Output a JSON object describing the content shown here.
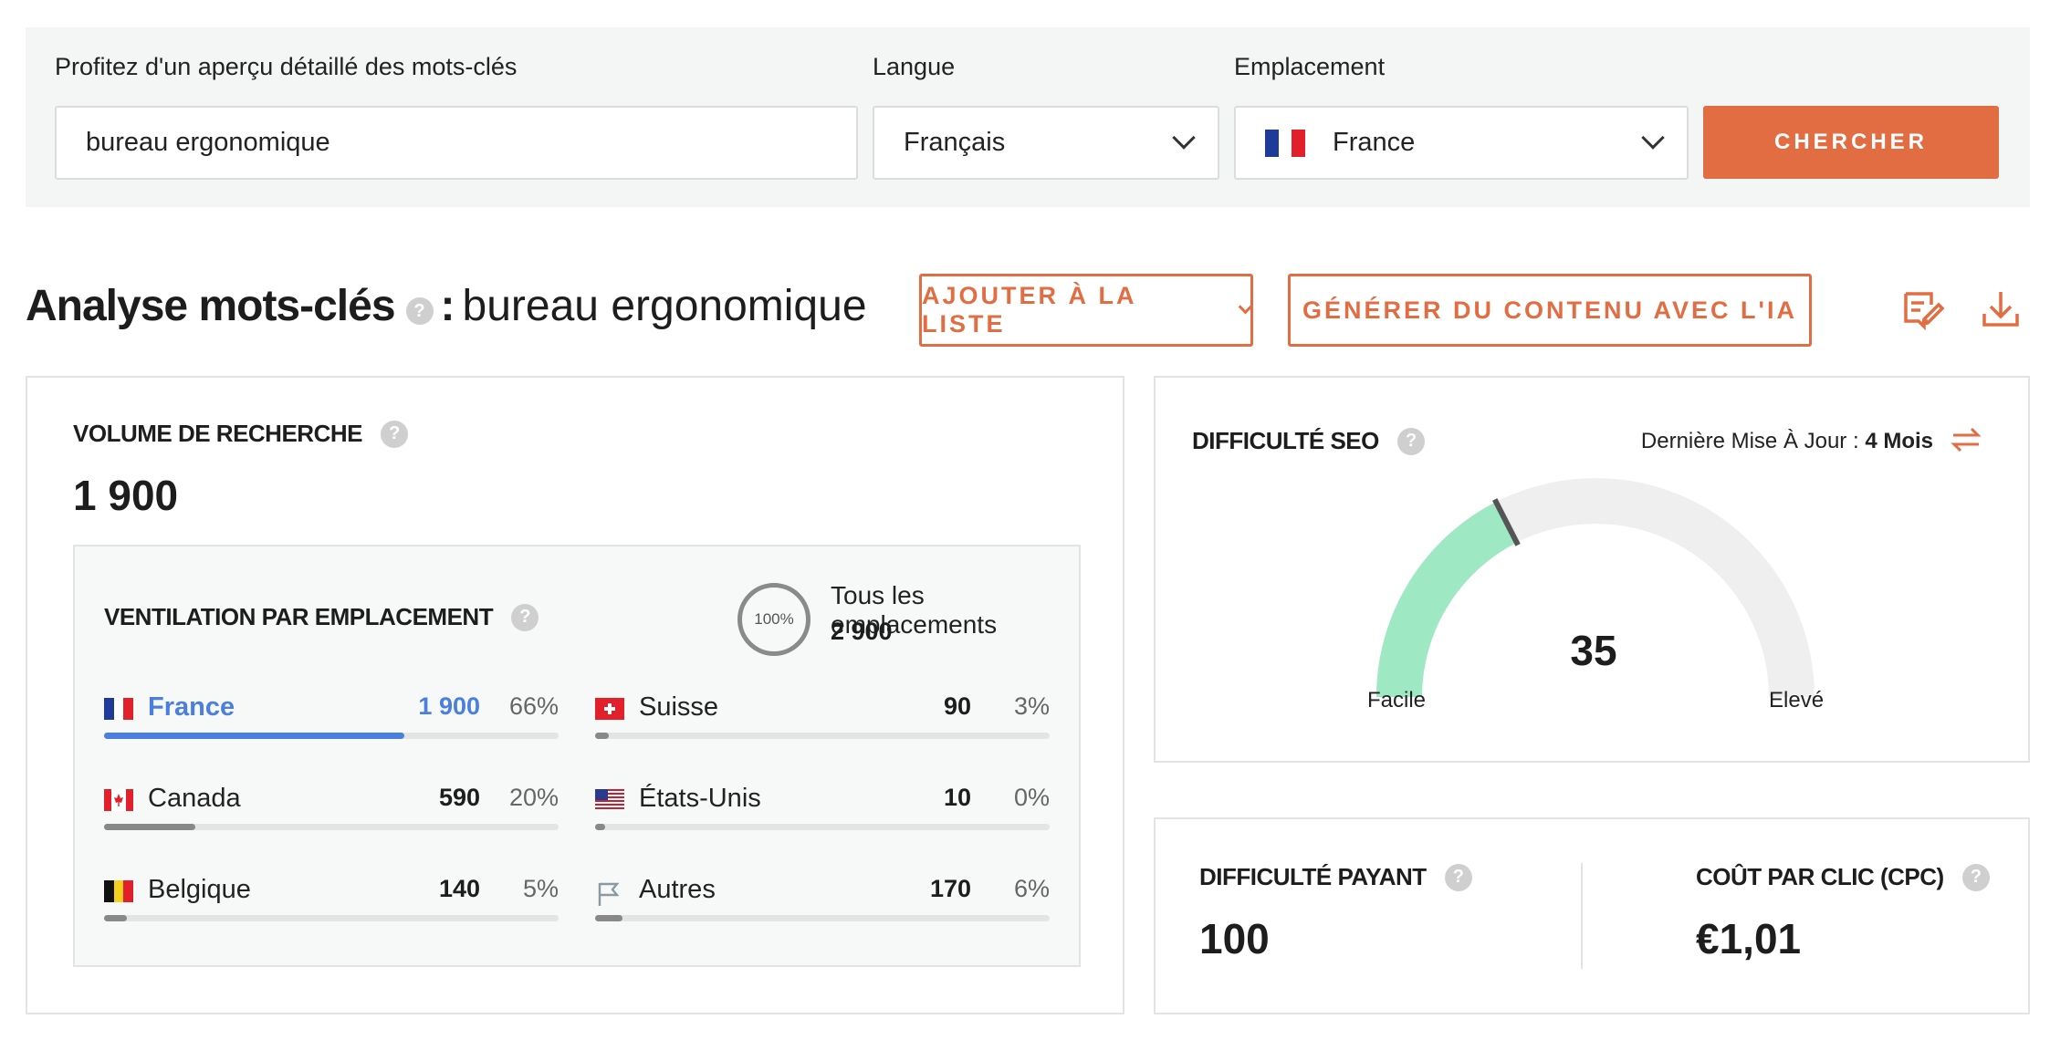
{
  "search": {
    "keyword_label": "Profitez d'un aperçu détaillé des mots-clés",
    "keyword_value": "bureau ergonomique",
    "language_label": "Langue",
    "language_value": "Français",
    "location_label": "Emplacement",
    "location_value": "France",
    "button_label": "CHERCHER"
  },
  "title": {
    "main": "Analyse mots-clés",
    "separator": ":",
    "keyword": "bureau ergonomique",
    "help": "?"
  },
  "actions": {
    "add_to_list": "AJOUTER À LA LISTE",
    "generate_ai": "GÉNÉRER DU CONTENU AVEC L'IA",
    "edit_icon": "edit-note-icon",
    "download_icon": "download-icon"
  },
  "volume": {
    "title": "VOLUME DE RECHERCHE",
    "value": "1 900",
    "breakdown": {
      "title": "VENTILATION PAR EMPLACEMENT",
      "ring_label": "100%",
      "all_label": "Tous les emplacements",
      "all_value": "2 900",
      "locations": [
        {
          "name": "France",
          "value": "1 900",
          "pct": "66%",
          "fraction": 0.66,
          "active": true
        },
        {
          "name": "Suisse",
          "value": "90",
          "pct": "3%",
          "fraction": 0.03
        },
        {
          "name": "Canada",
          "value": "590",
          "pct": "20%",
          "fraction": 0.2
        },
        {
          "name": "États-Unis",
          "value": "10",
          "pct": "0%",
          "fraction": 0.0
        },
        {
          "name": "Belgique",
          "value": "140",
          "pct": "5%",
          "fraction": 0.05
        },
        {
          "name": "Autres",
          "value": "170",
          "pct": "6%",
          "fraction": 0.06
        }
      ]
    }
  },
  "seo": {
    "title": "DIFFICULTÉ SEO",
    "updated_prefix": "Dernière Mise À Jour :",
    "updated_value": "4 Mois",
    "score": "35",
    "score_fraction": 0.35,
    "low_label": "Facile",
    "high_label": "Elevé",
    "refresh_icon": "refresh-icon"
  },
  "paid": {
    "title": "DIFFICULTÉ PAYANT",
    "value": "100"
  },
  "cpc": {
    "title": "COÛT PAR CLIC (CPC)",
    "value": "€1,01"
  },
  "colors": {
    "accent": "#e36d43",
    "active_blue": "#4a7fe0",
    "gauge_fill": "#9ee8c4",
    "gauge_track": "#efeff0"
  }
}
